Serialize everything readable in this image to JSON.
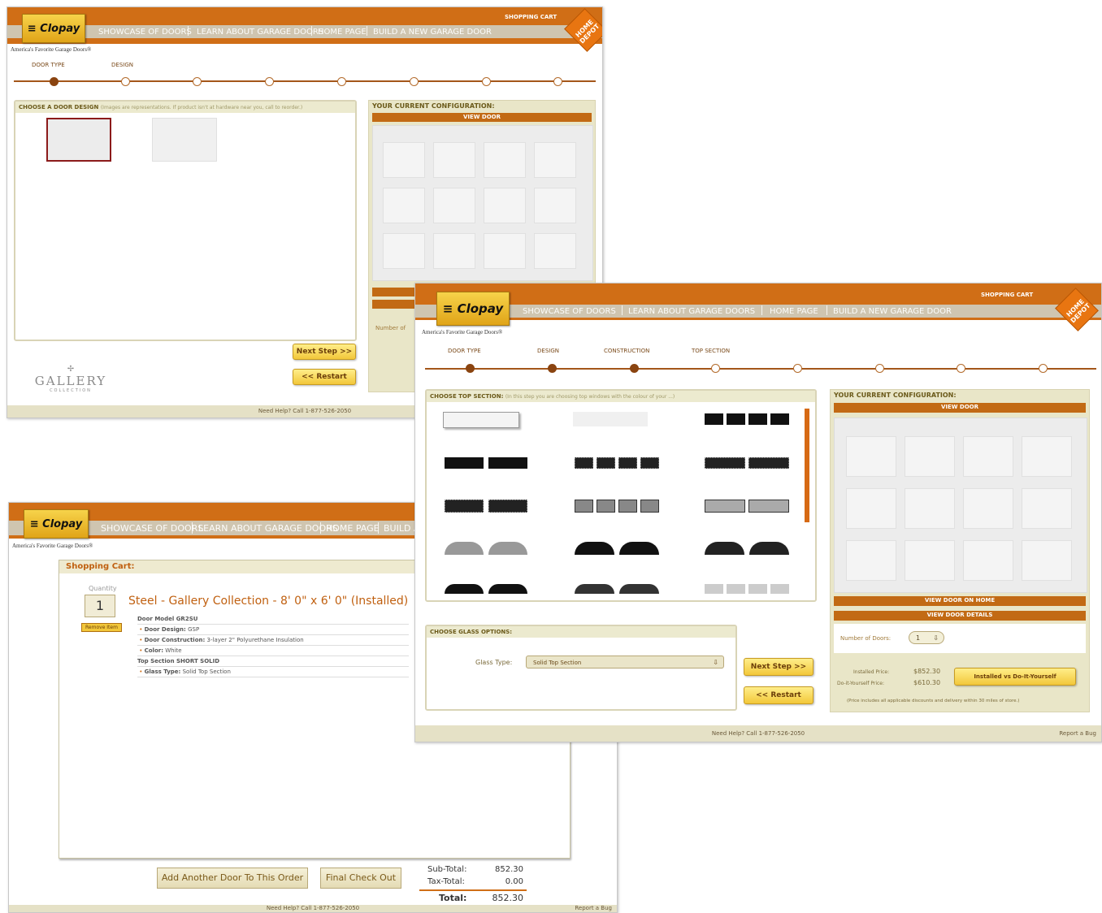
{
  "brand": {
    "logo": "Clopay",
    "tagline": "America's Favorite Garage Doors®",
    "retailer_badge": "HOME DEPOT"
  },
  "nav": {
    "items": [
      "SHOWCASE OF DOORS",
      "LEARN ABOUT GARAGE DOORS",
      "HOME PAGE",
      "BUILD A NEW GARAGE DOOR"
    ],
    "cart_link": "SHOPPING CART",
    "truncated_last": "BUILD A"
  },
  "design_window": {
    "steps": [
      "DOOR TYPE",
      "DESIGN"
    ],
    "panel_title": "CHOOSE A DOOR DESIGN",
    "panel_hint": "(Images are representations. If product isn't at hardware near you, call to reorder.)",
    "config_title": "YOUR CURRENT CONFIGURATION:",
    "view_door": "VIEW DOOR",
    "next_step": "Next Step >>",
    "restart": "<< Restart",
    "collection_logo": "GALLERY",
    "collection_sub": "COLLECTION",
    "help": "Need Help? Call 1-877-526-2050",
    "truncated_label": "Number of"
  },
  "top_window": {
    "steps": [
      "DOOR TYPE",
      "DESIGN",
      "CONSTRUCTION",
      "TOP SECTION"
    ],
    "panel_title": "CHOOSE TOP SECTION:",
    "panel_hint": "(In this step you are choosing top windows with the colour of your ...)",
    "glass_title": "CHOOSE GLASS OPTIONS:",
    "glass_label": "Glass Type:",
    "glass_value": "Solid Top Section",
    "config_title": "YOUR CURRENT CONFIGURATION:",
    "view_door": "VIEW DOOR",
    "view_on_home": "VIEW DOOR ON HOME",
    "view_details": "VIEW DOOR DETAILS",
    "num_doors_label": "Number of Doors:",
    "num_doors": "1",
    "installed_label": "Installed Price:",
    "installed_price": "$852.30",
    "diy_label": "Do-it-Yourself Price:",
    "diy_price": "$610.30",
    "toggle_btn": "Installed vs Do-It-Yourself",
    "price_note": "(Price includes all applicable discounts and delivery within 30 miles of store.)",
    "next_step": "Next Step >>",
    "restart": "<< Restart",
    "help": "Need Help? Call 1-877-526-2050",
    "report": "Report a Bug"
  },
  "cart_window": {
    "title": "Shopping Cart:",
    "qty_label": "Quantity",
    "qty": "1",
    "remove": "Remove Item",
    "item_title": "Steel - Gallery Collection - 8' 0\" x 6' 0\" (Installed)",
    "details": [
      {
        "label": "Door Model GR2SU",
        "value": ""
      },
      {
        "label": "Door Design:",
        "value": "GSP"
      },
      {
        "label": "Door Construction:",
        "value": "3-layer 2\" Polyurethane Insulation"
      },
      {
        "label": "Color:",
        "value": "White"
      },
      {
        "label": "Top Section SHORT SOLID",
        "value": ""
      },
      {
        "label": "Glass Type:",
        "value": "Solid Top Section"
      }
    ],
    "add_another": "Add Another Door To This Order",
    "final_checkout": "Final Check Out",
    "subtotal_label": "Sub-Total:",
    "subtotal": "852.30",
    "tax_label": "Tax-Total:",
    "tax": "0.00",
    "total_label": "Total:",
    "total": "852.30",
    "help": "Need Help? Call 1-877-526-2050",
    "report": "Report a Bug"
  },
  "colors": {
    "accent": "#d06e16",
    "panel": "#e9e6c8",
    "button": "#f2c73a"
  }
}
